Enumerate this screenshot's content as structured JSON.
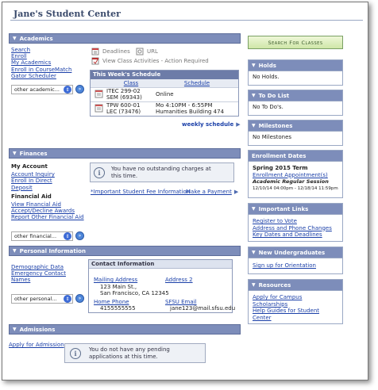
{
  "page": {
    "title": "Jane's Student Center"
  },
  "academics": {
    "header": "Academics",
    "links": [
      "Search",
      "Enroll",
      "My Academics",
      "Enroll in CourseMatch",
      "Gator Scheduler"
    ],
    "dropdown": "other academic...",
    "deadlines": "Deadlines",
    "url": "URL",
    "view_activities": "View Class Activities - Action Required",
    "schedule": {
      "title": "This Week's Schedule",
      "col_class": "Class",
      "col_schedule": "Schedule",
      "rows": [
        {
          "class_line1": "ITEC 299-02",
          "class_line2": "SEM (69343)",
          "sched_line1": "Online",
          "sched_line2": ""
        },
        {
          "class_line1": "TPW 600-01",
          "class_line2": "LEC (73476)",
          "sched_line1": "Mo 4:10PM - 6:55PM",
          "sched_line2": "Humanities Building 474"
        }
      ],
      "weekly_link": "weekly schedule"
    }
  },
  "finances": {
    "header": "Finances",
    "my_account_heading": "My Account",
    "my_account_links": [
      "Account Inquiry",
      "Enroll In Direct",
      "Deposit"
    ],
    "fin_aid_heading": "Financial Aid",
    "fin_aid_links": [
      "View Financial Aid",
      "Accept/Decline Awards",
      "Report Other Financial Aid"
    ],
    "dropdown": "other financial...",
    "info_message": "You have no outstanding charges at this time.",
    "fee_info_link": "*Important Student Fee Information",
    "make_payment_link": "Make a Payment"
  },
  "personal": {
    "header": "Personal Information",
    "links": [
      "Demographic Data",
      "Emergency Contact",
      "Names"
    ],
    "dropdown": "other personal...",
    "contact": {
      "title": "Contact Information",
      "mailing_label": "Mailing Address",
      "address2_label": "Address 2",
      "address_line1": "123 Main St.,",
      "address_line2": "San Francisco, CA 12345",
      "home_phone_label": "Home Phone",
      "home_phone": "4155555555",
      "email_label": "SFSU Email",
      "email": "jane123@mail.sfsu.edu"
    }
  },
  "admissions": {
    "header": "Admissions",
    "apply_link": "Apply for Admission",
    "info_message": "You do not have any pending applications at this time."
  },
  "sidebar": {
    "search_button": "Search For Classes",
    "holds": {
      "header": "Holds",
      "body": "No Holds."
    },
    "todo": {
      "header": "To Do List",
      "body": "No To Do's."
    },
    "milestones": {
      "header": "Milestones",
      "body": "No Milestones"
    },
    "enrollment": {
      "header": "Enrollment Dates",
      "term": "Spring 2015 Term",
      "appointment_link": "Enrollment Appointment(s)",
      "session": "Academic Regular Session",
      "dates": "12/10/14 04:00pm - 12/18/14 11:59pm"
    },
    "important_links": {
      "header": "Important Links",
      "links": [
        "Register to Vote",
        "Address and Phone Changes",
        "Key Dates and Deadlines"
      ]
    },
    "new_undergrads": {
      "header": "New Undergraduates",
      "link": "Sign up for Orientation"
    },
    "resources": {
      "header": "Resources",
      "links": [
        "Apply for Campus Scholarships",
        "Help Guides for Student Center"
      ]
    }
  }
}
